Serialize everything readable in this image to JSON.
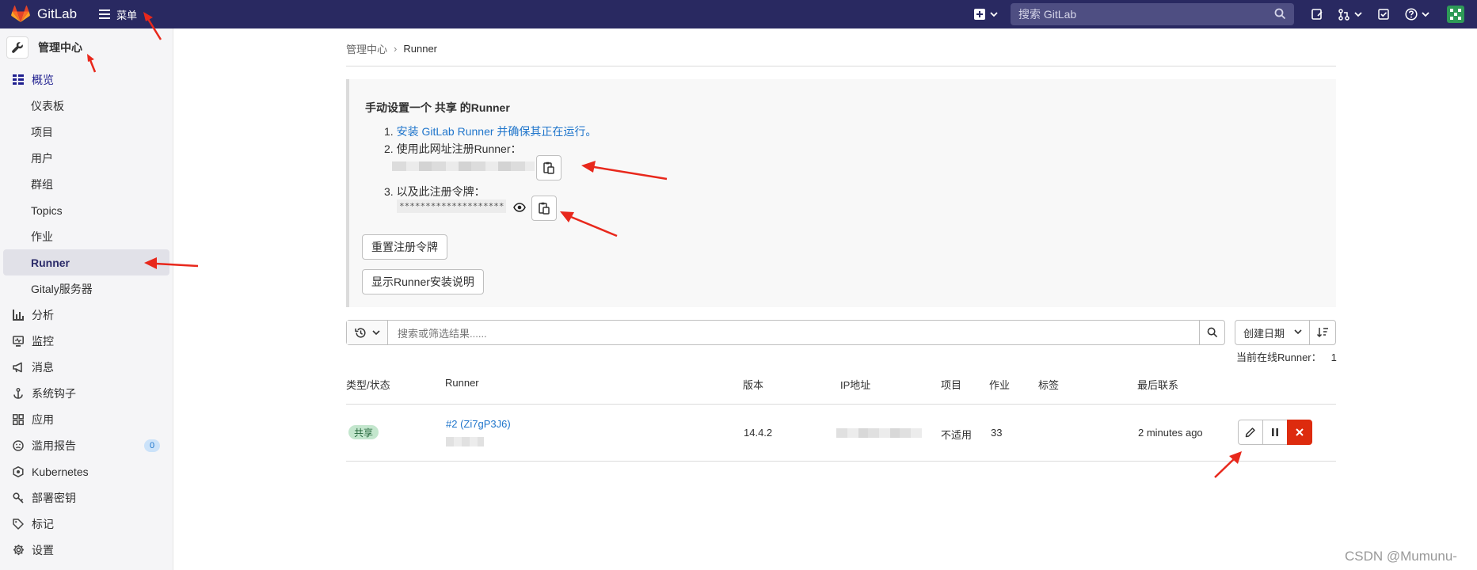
{
  "topbar": {
    "brand": "GitLab",
    "menu_label": "菜单",
    "search_placeholder": "搜索 GitLab",
    "icons": [
      "plus-square-icon",
      "chevron-down-icon",
      "search-icon",
      "issues-icon",
      "merge-request-icon",
      "todo-icon",
      "help-icon",
      "avatar"
    ]
  },
  "sidebar": {
    "title": "管理中心",
    "overview_label": "概览",
    "overview_items": [
      "仪表板",
      "项目",
      "用户",
      "群组",
      "Topics",
      "作业",
      "Runner",
      "Gitaly服务器"
    ],
    "sections": [
      {
        "label": "分析",
        "icon": "chart-icon"
      },
      {
        "label": "监控",
        "icon": "monitor-icon"
      },
      {
        "label": "消息",
        "icon": "bullhorn-icon"
      },
      {
        "label": "系统钩子",
        "icon": "hook-icon"
      },
      {
        "label": "应用",
        "icon": "applications-icon"
      },
      {
        "label": "滥用报告",
        "icon": "abuse-icon",
        "badge": "0"
      },
      {
        "label": "Kubernetes",
        "icon": "kubernetes-icon"
      },
      {
        "label": "部署密钥",
        "icon": "key-icon"
      },
      {
        "label": "标记",
        "icon": "label-icon"
      },
      {
        "label": "设置",
        "icon": "settings-icon"
      }
    ]
  },
  "breadcrumb": {
    "parent": "管理中心",
    "current": "Runner"
  },
  "setup": {
    "title": "手动设置一个 共享 的Runner",
    "step1_prefix": "1.",
    "step1_link": "安装 GitLab Runner 并确保其正在运行。",
    "step2": "2. 使用此网址注册Runner：",
    "step3": "3. 以及此注册令牌：",
    "token_masked": "********************",
    "reset_button": "重置注册令牌",
    "install_button": "显示Runner安装说明"
  },
  "filter": {
    "placeholder": "搜索或筛选结果......",
    "sort_label": "创建日期",
    "online_label": "当前在线Runner：",
    "online_count": "1"
  },
  "table": {
    "headers": [
      "类型/状态",
      "Runner",
      "版本",
      "IP地址",
      "项目",
      "作业",
      "标签",
      "最后联系"
    ],
    "row": {
      "type_badge": "共享",
      "runner_name": "#2 (Zi7gP3J6)",
      "version": "14.4.2",
      "projects": "不适用",
      "jobs": "33",
      "last_contact": "2 minutes ago"
    }
  },
  "watermark": "CSDN @Mumunu-",
  "colors": {
    "navbar": "#292961",
    "link": "#1f75cb",
    "danger": "#dd2b0e",
    "annotation": "#e8281c"
  }
}
